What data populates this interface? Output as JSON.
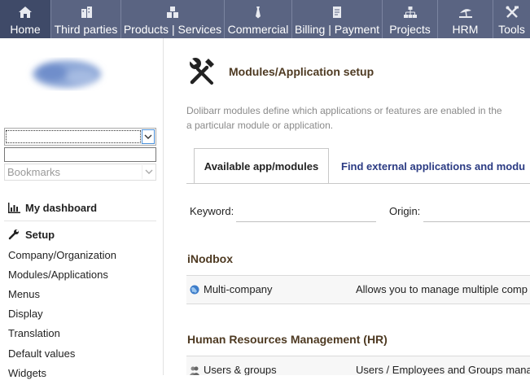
{
  "topmenu": [
    {
      "label": "Home",
      "icon": "home-icon",
      "active": true
    },
    {
      "label": "Third parties",
      "icon": "building-icon",
      "active": false
    },
    {
      "label": "Products | Services",
      "icon": "boxes-icon",
      "active": false
    },
    {
      "label": "Commercial",
      "icon": "tie-icon",
      "active": false
    },
    {
      "label": "Billing | Payment",
      "icon": "bill-icon",
      "active": false
    },
    {
      "label": "Projects",
      "icon": "sitemap-icon",
      "active": false
    },
    {
      "label": "HRM",
      "icon": "beach-icon",
      "active": false
    },
    {
      "label": "Tools",
      "icon": "tools-icon",
      "active": false
    }
  ],
  "left": {
    "bookmarks": "Bookmarks",
    "dashboard": "My dashboard",
    "setup": "Setup",
    "items": [
      "Company/Organization",
      "Modules/Applications",
      "Menus",
      "Display",
      "Translation",
      "Default values",
      "Widgets"
    ]
  },
  "main": {
    "title": "Modules/Application setup",
    "desc_line1": "Dolibarr modules define which applications or features are enabled in the",
    "desc_line2": "a particular module or application.",
    "tab_active": "Available app/modules",
    "tab_other": "Find external applications and modu",
    "keyword_label": "Keyword:",
    "origin_label": "Origin:"
  },
  "sections": [
    {
      "title": "iNodbox",
      "modules": [
        {
          "name": "Multi-company",
          "desc": "Allows you to manage multiple comp"
        }
      ]
    },
    {
      "title": "Human Resources Management (HR)",
      "modules": [
        {
          "name": "Users & groups",
          "desc": "Users / Employees and Groups mana"
        }
      ]
    }
  ],
  "colors": {
    "topbar": "#5a6482",
    "topbar_active": "#3f4a68",
    "title": "#4e3a22",
    "tab_link": "#2b3b83"
  }
}
